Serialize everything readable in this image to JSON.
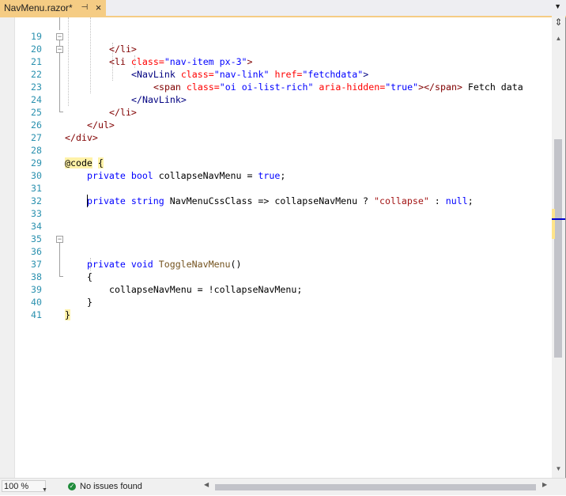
{
  "tab": {
    "title": "NavMenu.razor*",
    "pin_glyph": "⊣",
    "close_glyph": "×",
    "dropdown_glyph": "▼"
  },
  "editor": {
    "lines": [
      {
        "num": "19"
      },
      {
        "num": "20"
      },
      {
        "num": "21"
      },
      {
        "num": "22"
      },
      {
        "num": "23"
      },
      {
        "num": "24"
      },
      {
        "num": "25"
      },
      {
        "num": "26"
      },
      {
        "num": "27"
      },
      {
        "num": "28"
      },
      {
        "num": "29"
      },
      {
        "num": "30"
      },
      {
        "num": "31"
      },
      {
        "num": "32"
      },
      {
        "num": "33"
      },
      {
        "num": "34"
      },
      {
        "num": "35"
      },
      {
        "num": "36"
      },
      {
        "num": "37"
      },
      {
        "num": "38"
      },
      {
        "num": "39"
      },
      {
        "num": "40"
      },
      {
        "num": "41"
      }
    ],
    "tokens": {
      "l19": "</li>",
      "l20_open": "<li",
      "l20_attr": " class=",
      "l20_val": "\"nav-item px-3\"",
      "l20_close": ">",
      "l21_open": "<NavLink",
      "l21_attr1": " class=",
      "l21_val1": "\"nav-link\"",
      "l21_attr2": " href=",
      "l21_val2": "\"fetchdata\"",
      "l21_close": ">",
      "l22_open": "<span",
      "l22_attr1": " class=",
      "l22_val1": "\"oi oi-list-rich\"",
      "l22_attr2": " aria-hidden=",
      "l22_val2": "\"true\"",
      "l22_end": "></span>",
      "l22_text": " Fetch data",
      "l23": "</NavLink>",
      "l24": "</li>",
      "l25": "</ul>",
      "l26": "</div>",
      "l28_directive": "@code",
      "l28_brace": "{",
      "l29_kw1": "private",
      "l29_kw2": "bool",
      "l29_rest": " collapseNavMenu = ",
      "l29_kw3": "true",
      "l29_end": ";",
      "l31_kw1": "private",
      "l31_kw2": "string",
      "l31_rest": " NavMenuCssClass => collapseNavMenu ? ",
      "l31_str": "\"collapse\"",
      "l31_mid": " : ",
      "l31_kw3": "null",
      "l31_end": ";",
      "l36_kw1": "private",
      "l36_kw2": "void",
      "l36_method": "ToggleNavMenu",
      "l36_end": "()",
      "l37": "{",
      "l38": "collapseNavMenu = !collapseNavMenu;",
      "l39": "}",
      "l40": "}"
    }
  },
  "scrollbar": {
    "split_glyph": "⇕",
    "up_glyph": "▲",
    "down_glyph": "▼",
    "left_glyph": "◀",
    "right_glyph": "▶"
  },
  "statusbar": {
    "zoom": "100 %",
    "zoom_glyph": "▼",
    "ok_glyph": "✓",
    "status": "No issues found"
  },
  "colors": {
    "tab_active": "#f5cc84",
    "line_number": "#2b91af",
    "keyword": "#0000ff",
    "tag": "#800000",
    "attribute": "#ff0000",
    "string": "#a31515",
    "method": "#74531f",
    "brace_highlight": "#fff2a8"
  }
}
